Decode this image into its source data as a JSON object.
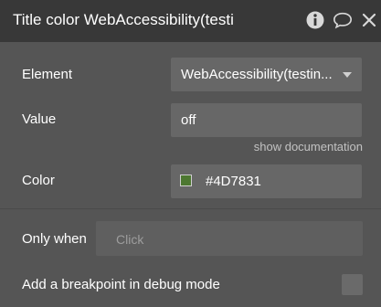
{
  "header": {
    "title": "Title color WebAccessibility(testi",
    "icons": [
      "info-icon",
      "comment-icon",
      "close-icon"
    ]
  },
  "element_row": {
    "label": "Element",
    "selected": "WebAccessibility(testin..."
  },
  "value_row": {
    "label": "Value",
    "value": "off",
    "doc_link": "show documentation"
  },
  "color_row": {
    "label": "Color",
    "hex": "#4D7831",
    "swatch_color": "#4D7831"
  },
  "only_when_row": {
    "label": "Only when",
    "placeholder": "Click"
  },
  "breakpoint_row": {
    "label": "Add a breakpoint in debug mode",
    "checked": false
  }
}
